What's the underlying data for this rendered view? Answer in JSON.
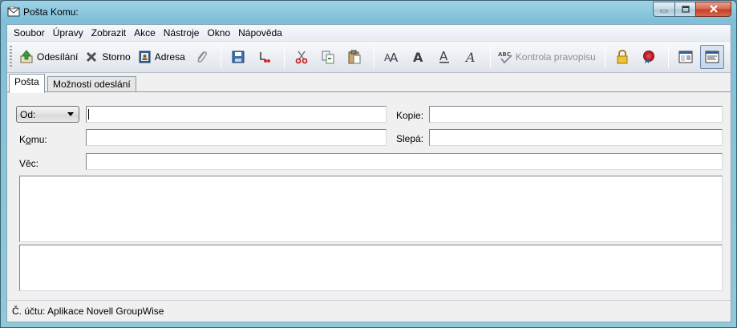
{
  "window": {
    "title": "Pošta Komu:"
  },
  "menu": [
    "Soubor",
    "Úpravy",
    "Zobrazit",
    "Akce",
    "Nástroje",
    "Okno",
    "Nápověda"
  ],
  "toolbar": {
    "send_label": "Odesílání",
    "cancel_label": "Storno",
    "address_label": "Adresa",
    "spell_label": "Kontrola pravopisu",
    "spell_icon_text": "ABC",
    "font_glyph": "A"
  },
  "tabs": [
    "Pošta",
    "Možnosti odeslání"
  ],
  "form": {
    "from_value": "Od:",
    "to_label_pre": "K",
    "to_label_u": "o",
    "to_label_post": "mu:",
    "subject_label": "Věc:",
    "cc_label": "Kopie:",
    "bcc_label": "Slepá:"
  },
  "status": "Č. účtu: Aplikace Novell GroupWise",
  "colors": {
    "accent": "#6b8aa8",
    "titlebar": "#8fcad9",
    "close": "#c43d22"
  }
}
